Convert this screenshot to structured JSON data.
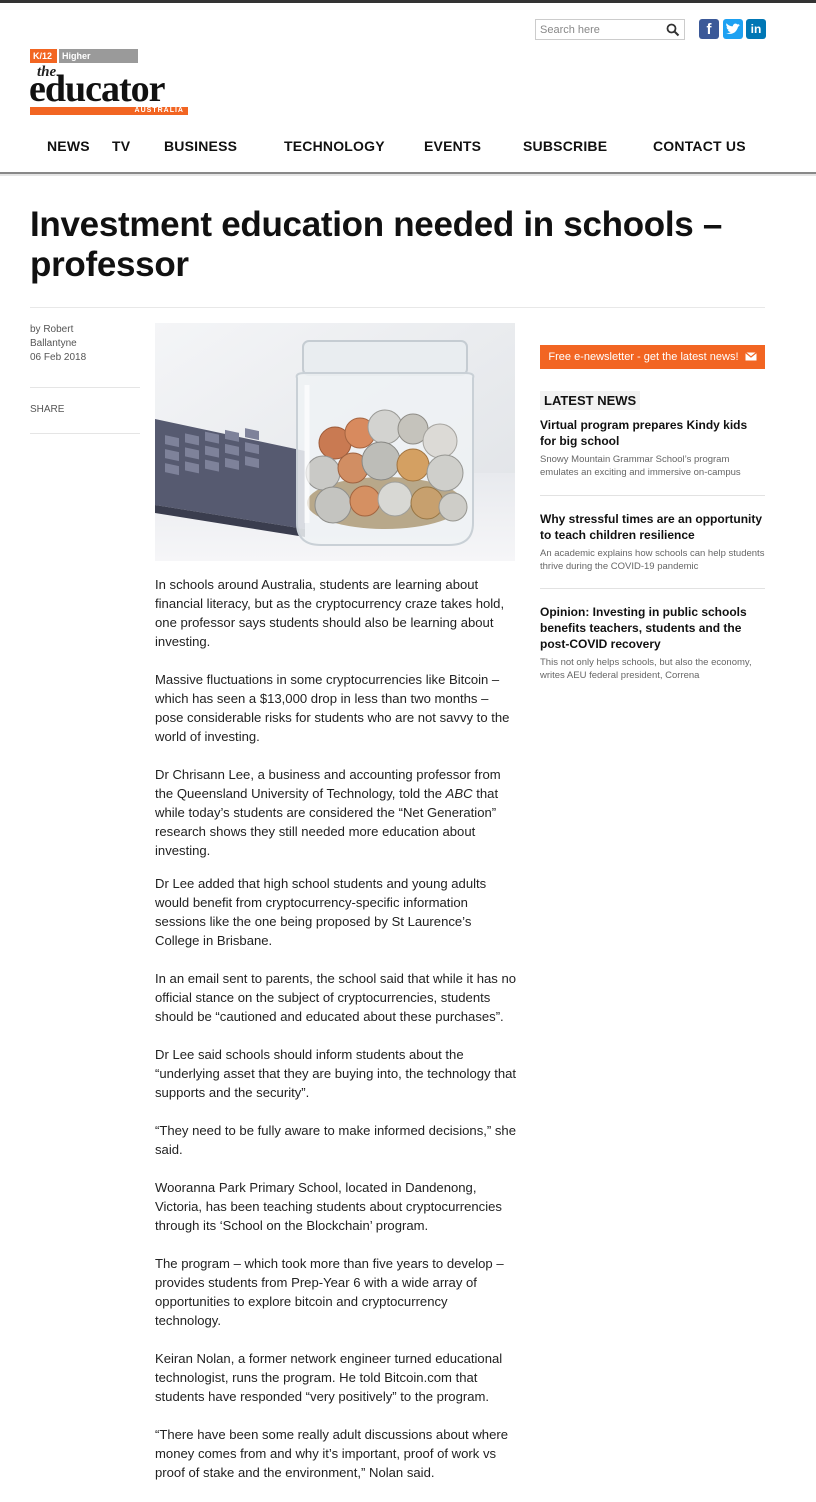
{
  "search": {
    "placeholder": "Search here"
  },
  "social": {
    "facebook": "f",
    "twitter": "t",
    "linkedin": "in"
  },
  "brand": {
    "tag_k12": "K/12",
    "tag_higher": "Higher Education",
    "logo_the": "the",
    "logo_main": "educator",
    "logo_sub": "AUSTRALIA",
    "accent": "#f26522"
  },
  "nav": [
    {
      "label": "NEWS"
    },
    {
      "label": "TV"
    },
    {
      "label": "BUSINESS"
    },
    {
      "label": "TECHNOLOGY"
    },
    {
      "label": "EVENTS"
    },
    {
      "label": "SUBSCRIBE"
    },
    {
      "label": "CONTACT US"
    }
  ],
  "article": {
    "title": "Investment education needed in schools – professor",
    "author_line1": "by Robert",
    "author_line2": "Ballantyne",
    "date": "06 Feb 2018",
    "share": "SHARE",
    "hero_image": "jar-of-coins-with-calculator",
    "p1": "In schools around Australia, students are learning about financial literacy, but as the cryptocurrency craze takes hold, one professor says students should also be learning about investing.",
    "p2": "Massive fluctuations in some cryptocurrencies like Bitcoin – which has seen a $13,000 drop in less than two months – pose considerable risks for students who are not savvy to the world of investing.",
    "p3_a": "Dr Chrisann Lee, a business and accounting professor from the Queensland University of Technology, told the ",
    "p3_abc": "ABC",
    "p3_b": " that while today’s students are considered the “Net Generation” research shows they still needed more education about investing.",
    "p4": "Dr Lee added that high school students and young adults would benefit from cryptocurrency-specific information sessions like the one being proposed by St Laurence’s College in Brisbane.",
    "p5": "In an email sent to parents, the school said that while it has no official stance on the subject of cryptocurrencies, students should be “cautioned and educated about these purchases”.",
    "p6": "Dr Lee said schools should inform students about the “underlying asset that they are buying into, the technology that supports and the security”.",
    "p7": "“They need to be fully aware to make informed decisions,” she said.",
    "p8": "Wooranna Park Primary School, located in Dandenong, Victoria, has been teaching students about cryptocurrencies through its ‘School on the Blockchain’ program.",
    "p9": "The program – which took more than five years to develop – provides students from Prep-Year 6 with a wide array of opportunities to explore bitcoin and cryptocurrency technology.",
    "p10": "Keiran Nolan, a former network engineer turned educational technologist, runs the program. He told Bitcoin.com that students have responded “very positively” to the program.",
    "p11": "“There have been some really adult discussions about where money comes from and why it’s important, proof of work vs proof of stake and the environment,” Nolan said."
  },
  "sidebar": {
    "newsletter": "Free e-newsletter - get the latest news!",
    "latest_heading": "LATEST NEWS",
    "items": [
      {
        "title": "Virtual program prepares Kindy kids for big school",
        "desc": "Snowy Mountain Grammar School’s program emulates an exciting and immersive on-campus"
      },
      {
        "title": "Why stressful times are an opportunity to teach children resilience",
        "desc": "An academic explains how schools can help students thrive during the COVID-19 pandemic"
      },
      {
        "title": "Opinion: Investing in public schools benefits teachers, students and the post-COVID recovery",
        "desc": "This not only helps schools, but also the economy, writes AEU federal president, Correna"
      }
    ]
  }
}
